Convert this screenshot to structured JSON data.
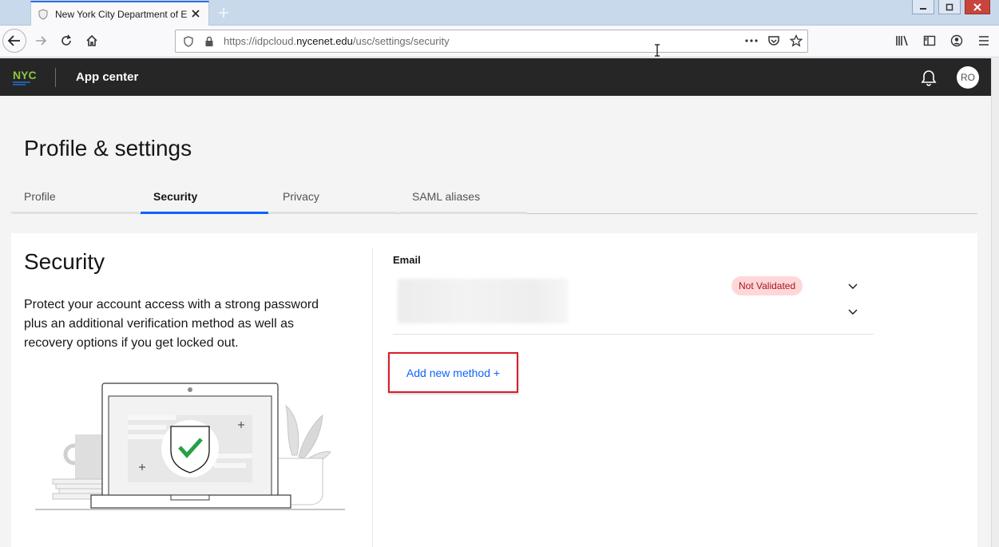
{
  "browser": {
    "tab_title": "New York City Department of E",
    "url_scheme": "https://idpcloud.",
    "url_host": "nycenet.edu",
    "url_path": "/usc/settings/security"
  },
  "app": {
    "logo_text": "NYC",
    "title": "App center",
    "avatar_initials": "RO"
  },
  "page": {
    "title": "Profile & settings",
    "tabs": [
      {
        "label": "Profile",
        "active": false
      },
      {
        "label": "Security",
        "active": true
      },
      {
        "label": "Privacy",
        "active": false
      },
      {
        "label": "SAML aliases",
        "active": false
      }
    ]
  },
  "security": {
    "heading": "Security",
    "description": "Protect your account access with a strong password plus an additional verification method as well as recovery options if you get locked out.",
    "email_label": "Email",
    "status_badge": "Not Validated",
    "add_method_label": "Add new method +"
  },
  "colors": {
    "accent": "#0f62fe",
    "header_bg": "#262626",
    "badge_bg": "#ffd7d9",
    "badge_text": "#a2191f",
    "highlight_box": "#da1e28"
  }
}
